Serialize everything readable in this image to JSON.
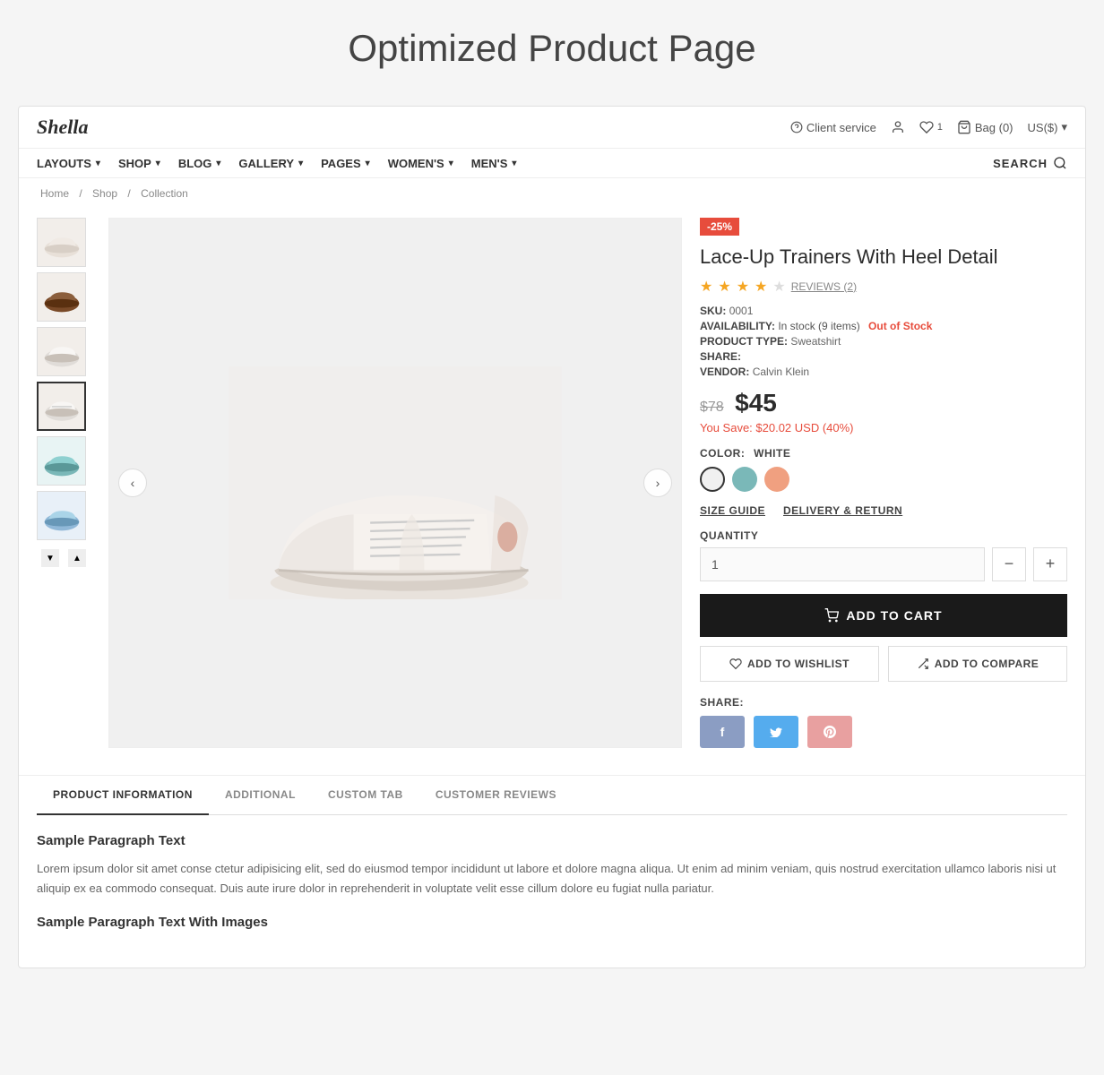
{
  "pageTitle": "Optimized Product Page",
  "header": {
    "logo": "Shella",
    "clientService": "Client service",
    "wishlistCount": "1",
    "bag": "Bag (0)",
    "currency": "US($)",
    "currencyArrow": "▾"
  },
  "nav": {
    "items": [
      {
        "label": "LAYOUTS",
        "hasArrow": true
      },
      {
        "label": "SHOP",
        "hasArrow": true
      },
      {
        "label": "BLOG",
        "hasArrow": true
      },
      {
        "label": "GALLERY",
        "hasArrow": true
      },
      {
        "label": "PAGES",
        "hasArrow": true
      },
      {
        "label": "WOMEN'S",
        "hasArrow": true
      },
      {
        "label": "MEN'S",
        "hasArrow": true
      }
    ],
    "searchLabel": "SEARCH"
  },
  "breadcrumb": {
    "home": "Home",
    "shop": "Shop",
    "collection": "Collection"
  },
  "product": {
    "badge": "-25%",
    "name": "Lace-Up Trainers With Heel Detail",
    "rating": 3.5,
    "reviewsCount": "REVIEWS (2)",
    "sku": "0001",
    "availability": "In stock (9 items)",
    "availabilityStatus": "Out of Stock",
    "productType": "Sweatshirt",
    "share": "SHARE:",
    "vendor": "Calvin Klein",
    "originalPrice": "$78",
    "salePrice": "$45",
    "savings": "You Save: $20.02 USD (40%)",
    "colorLabel": "COLOR:",
    "colorValue": "WHITE",
    "colors": [
      {
        "name": "white",
        "label": "White"
      },
      {
        "name": "teal",
        "label": "Teal"
      },
      {
        "name": "peach",
        "label": "Peach"
      }
    ],
    "sizeGuide": "SIZE GUIDE",
    "deliveryReturn": "DELIVERY & RETURN",
    "quantityLabel": "QUANTITY",
    "quantity": "1",
    "quantityDecrement": "−",
    "quantityIncrement": "+",
    "addToCart": "ADD TO CART",
    "addToWishlist": "ADD TO WISHLIST",
    "addToCompare": "ADD TO COMPARE",
    "shareLabel": "SHARE:",
    "socialButtons": [
      {
        "name": "facebook",
        "icon": "f"
      },
      {
        "name": "twitter",
        "icon": "t"
      },
      {
        "name": "pinterest",
        "icon": "p"
      }
    ]
  },
  "tabs": [
    {
      "label": "PRODUCT INFORMATION",
      "active": true
    },
    {
      "label": "ADDITIONAL",
      "active": false
    },
    {
      "label": "CUSTOM TAB",
      "active": false
    },
    {
      "label": "CUSTOMER REVIEWS",
      "active": false
    }
  ],
  "tabContent": {
    "heading1": "Sample Paragraph Text",
    "paragraph1": "Lorem ipsum dolor sit amet conse ctetur adipisicing elit, sed do eiusmod tempor incididunt ut labore et dolore magna aliqua. Ut enim ad minim veniam, quis nostrud exercitation ullamco laboris nisi ut aliquip ex ea commodo consequat. Duis aute irure dolor in reprehenderit in voluptate velit esse cillum dolore eu fugiat nulla pariatur.",
    "heading2": "Sample Paragraph Text With Images"
  }
}
